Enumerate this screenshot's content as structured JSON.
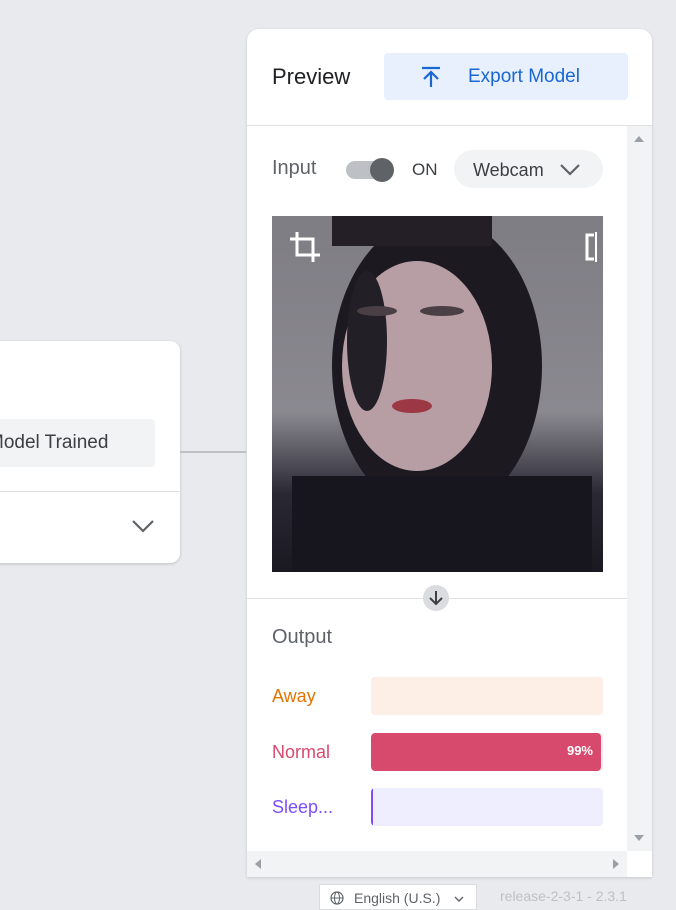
{
  "training": {
    "status_label": "Model Trained"
  },
  "preview": {
    "title": "Preview",
    "export_label": "Export Model"
  },
  "input": {
    "label": "Input",
    "toggle_state": "ON",
    "source": "Webcam"
  },
  "output": {
    "label": "Output",
    "classes": [
      {
        "name": "Away",
        "confidence": 0,
        "pct_label": "",
        "color": "#e37400",
        "track": "#fdeee6"
      },
      {
        "name": "Normal",
        "confidence": 99,
        "pct_label": "99%",
        "color": "#d84a6d",
        "track": "#fce8ec"
      },
      {
        "name": "Sleep...",
        "confidence": 1,
        "pct_label": "",
        "color": "#7c4dff",
        "track": "#efeefe"
      }
    ]
  },
  "footer": {
    "language": "English (U.S.)",
    "release": "release-2-3-1 - 2.3.1"
  },
  "colors": {
    "accent": "#1967d2",
    "export_bg": "#e8f0fe"
  },
  "icons": [
    "upload-icon",
    "chevron-down-icon",
    "crop-icon",
    "flip-icon",
    "arrow-down-icon",
    "globe-icon"
  ]
}
